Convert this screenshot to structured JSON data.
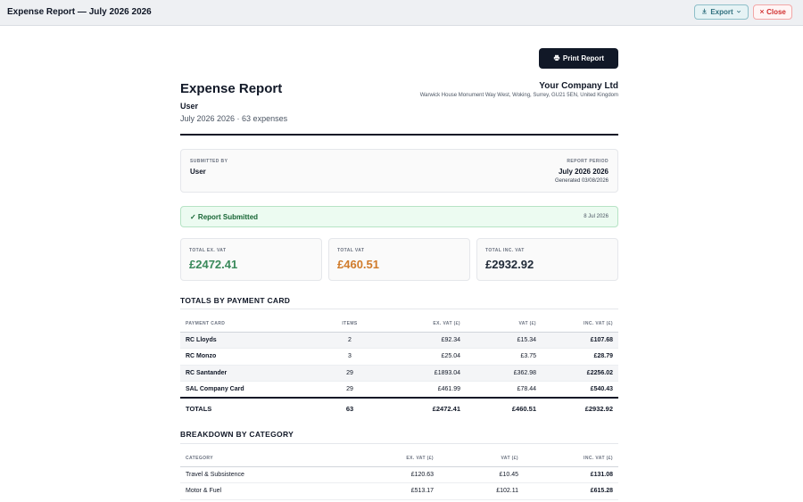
{
  "window": {
    "title": "Expense Report — July 2026 2026",
    "export_label": "Export",
    "close_label": "Close"
  },
  "report": {
    "print_label": "Print Report",
    "title": "Expense Report",
    "user": "User",
    "subtitle": "July 2026 2026 · 63 expenses",
    "company": "Your Company Ltd",
    "address": "Warwick House Monument Way West, Woking, Surrey, GU21 5EN, United Kingdom"
  },
  "info": {
    "submitted_by_label": "SUBMITTED BY",
    "submitted_by": "User",
    "period_label": "REPORT PERIOD",
    "period": "July 2026 2026",
    "generated": "Generated 03/08/2026"
  },
  "status": {
    "text": "✓ Report Submitted",
    "date": "8 Jul 2026"
  },
  "totals": {
    "ex_vat_label": "TOTAL EX. VAT",
    "ex_vat": "£2472.41",
    "vat_label": "TOTAL VAT",
    "vat": "£460.51",
    "inc_vat_label": "TOTAL INC. VAT",
    "inc_vat": "£2932.92"
  },
  "by_card": {
    "title": "TOTALS BY PAYMENT CARD",
    "headers": [
      "PAYMENT CARD",
      "ITEMS",
      "EX. VAT (£)",
      "VAT (£)",
      "INC. VAT (£)"
    ],
    "rows": [
      [
        "RC Lloyds",
        "2",
        "£92.34",
        "£15.34",
        "£107.68"
      ],
      [
        "RC Monzo",
        "3",
        "£25.04",
        "£3.75",
        "£28.79"
      ],
      [
        "RC Santander",
        "29",
        "£1893.04",
        "£362.98",
        "£2256.02"
      ],
      [
        "SAL Company Card",
        "29",
        "£461.99",
        "£78.44",
        "£540.43"
      ]
    ],
    "total": [
      "TOTALS",
      "63",
      "£2472.41",
      "£460.51",
      "£2932.92"
    ]
  },
  "by_category": {
    "title": "BREAKDOWN BY CATEGORY",
    "headers": [
      "CATEGORY",
      "EX. VAT (£)",
      "VAT (£)",
      "INC. VAT (£)"
    ],
    "rows": [
      [
        "Travel & Subsistence",
        "£120.63",
        "£10.45",
        "£131.08"
      ],
      [
        "Motor & Fuel",
        "£513.17",
        "£102.11",
        "£615.28"
      ]
    ]
  },
  "colors": {
    "ex_vat": "#3a8a5b",
    "vat": "#d07b2a",
    "inc_vat": "#1f2937"
  }
}
